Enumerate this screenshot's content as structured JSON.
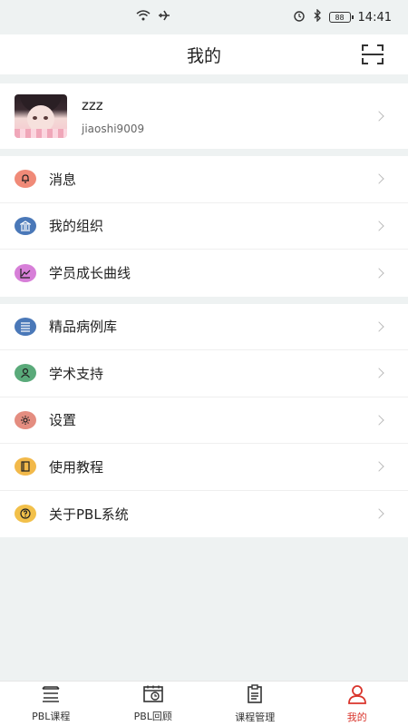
{
  "status_bar": {
    "time": "14:41",
    "battery": "88",
    "icons": [
      "wifi-icon",
      "airplane-icon",
      "alarm-icon",
      "bluetooth-icon",
      "battery-icon"
    ]
  },
  "header": {
    "title": "我的",
    "scan_icon": "scan-icon"
  },
  "profile": {
    "name": "zzz",
    "username": "jiaoshi9009"
  },
  "menu_group_1": [
    {
      "label": "消息",
      "icon": "bell-icon",
      "color": "#f08a78"
    },
    {
      "label": "我的组织",
      "icon": "building-icon",
      "color": "#4a78b8"
    },
    {
      "label": "学员成长曲线",
      "icon": "chart-icon",
      "color": "#d77fd8"
    }
  ],
  "menu_group_2": [
    {
      "label": "精品病例库",
      "icon": "list-icon",
      "color": "#4a78b8"
    },
    {
      "label": "学术支持",
      "icon": "person-icon",
      "color": "#5aaa7a"
    },
    {
      "label": "设置",
      "icon": "gear-icon",
      "color": "#e48d80"
    },
    {
      "label": "使用教程",
      "icon": "book-icon",
      "color": "#f2b94a"
    },
    {
      "label": "关于PBL系统",
      "icon": "question-icon",
      "color": "#f2c04a"
    }
  ],
  "tabbar": [
    {
      "label": "PBL课程",
      "icon": "layers-icon",
      "active": false
    },
    {
      "label": "PBL回顾",
      "icon": "calendar-clock-icon",
      "active": false
    },
    {
      "label": "课程管理",
      "icon": "clipboard-icon",
      "active": false
    },
    {
      "label": "我的",
      "icon": "user-icon",
      "active": true
    }
  ],
  "colors": {
    "accent": "#d9342b",
    "background": "#eef2f2"
  }
}
